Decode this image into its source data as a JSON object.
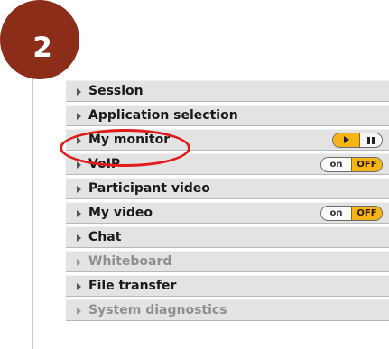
{
  "step": {
    "number": "2"
  },
  "panels": [
    {
      "label": "Session",
      "disabled": false,
      "control": "none"
    },
    {
      "label": "Application selection",
      "disabled": false,
      "control": "none"
    },
    {
      "label": "My monitor",
      "disabled": false,
      "control": "player",
      "control_icons": [
        "play-icon",
        "pause-icon"
      ]
    },
    {
      "label": "VoIP",
      "disabled": false,
      "control": "toggle",
      "on_label": "on",
      "off_label": "OFF",
      "state": "OFF"
    },
    {
      "label": "Participant video",
      "disabled": false,
      "control": "none"
    },
    {
      "label": "My video",
      "disabled": false,
      "control": "toggle",
      "on_label": "on",
      "off_label": "OFF",
      "state": "OFF"
    },
    {
      "label": "Chat",
      "disabled": false,
      "control": "none"
    },
    {
      "label": "Whiteboard",
      "disabled": true,
      "control": "none"
    },
    {
      "label": "File transfer",
      "disabled": false,
      "control": "none"
    },
    {
      "label": "System diagnostics",
      "disabled": true,
      "control": "none"
    }
  ],
  "highlight": {
    "target": "My monitor",
    "color": "#e01b1b"
  },
  "colors": {
    "badge": "#8c2d19",
    "accent": "#f7b416",
    "row_bg": "#e3e3e3",
    "disabled_text": "#8f8f8f"
  }
}
